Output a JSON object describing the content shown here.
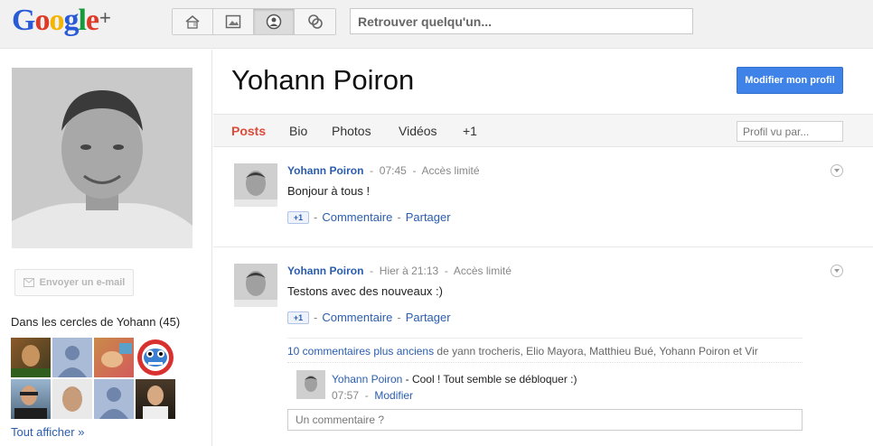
{
  "header": {
    "logo_text": "Google",
    "logo_plus": "+",
    "nav": [
      {
        "icon": "home-icon"
      },
      {
        "icon": "photos-icon"
      },
      {
        "icon": "profile-icon"
      },
      {
        "icon": "circles-icon"
      }
    ],
    "search_placeholder": "Retrouver quelqu'un..."
  },
  "sidebar": {
    "email_button": "Envoyer un e-mail",
    "circles_title": "Dans les cercles de Yohann (45)",
    "show_all": "Tout afficher »"
  },
  "profile": {
    "name": "Yohann Poiron",
    "edit_button": "Modifier mon profil",
    "tabs": [
      "Posts",
      "Bio",
      "Photos",
      "Vidéos",
      "+1"
    ],
    "active_tab": "Posts",
    "viewed_by_placeholder": "Profil vu par..."
  },
  "posts": [
    {
      "author": "Yohann Poiron",
      "time": "07:45",
      "visibility": "Accès limité",
      "text": "Bonjour à tous !",
      "plusone": "+1",
      "comment_link": "Commentaire",
      "share_link": "Partager"
    },
    {
      "author": "Yohann Poiron",
      "time": "Hier à 21:13",
      "visibility": "Accès limité",
      "text": "Testons avec des nouveaux :)",
      "plusone": "+1",
      "comment_link": "Commentaire",
      "share_link": "Partager",
      "older_comments_link": "10 commentaires plus anciens",
      "older_comments_people": " de yann trocheris, Elio Mayora, Matthieu Bué, Yohann Poiron et Vir",
      "comment": {
        "author": "Yohann Poiron",
        "text": " - Cool ! Tout semble se débloquer :)",
        "time": "07:57",
        "edit_link": "Modifier"
      },
      "comment_placeholder": "Un commentaire ?"
    }
  ],
  "separator": "-",
  "colors": {
    "accent_blue": "#3f83e8",
    "link": "#2a5db0",
    "active_tab": "#dd4b39"
  }
}
